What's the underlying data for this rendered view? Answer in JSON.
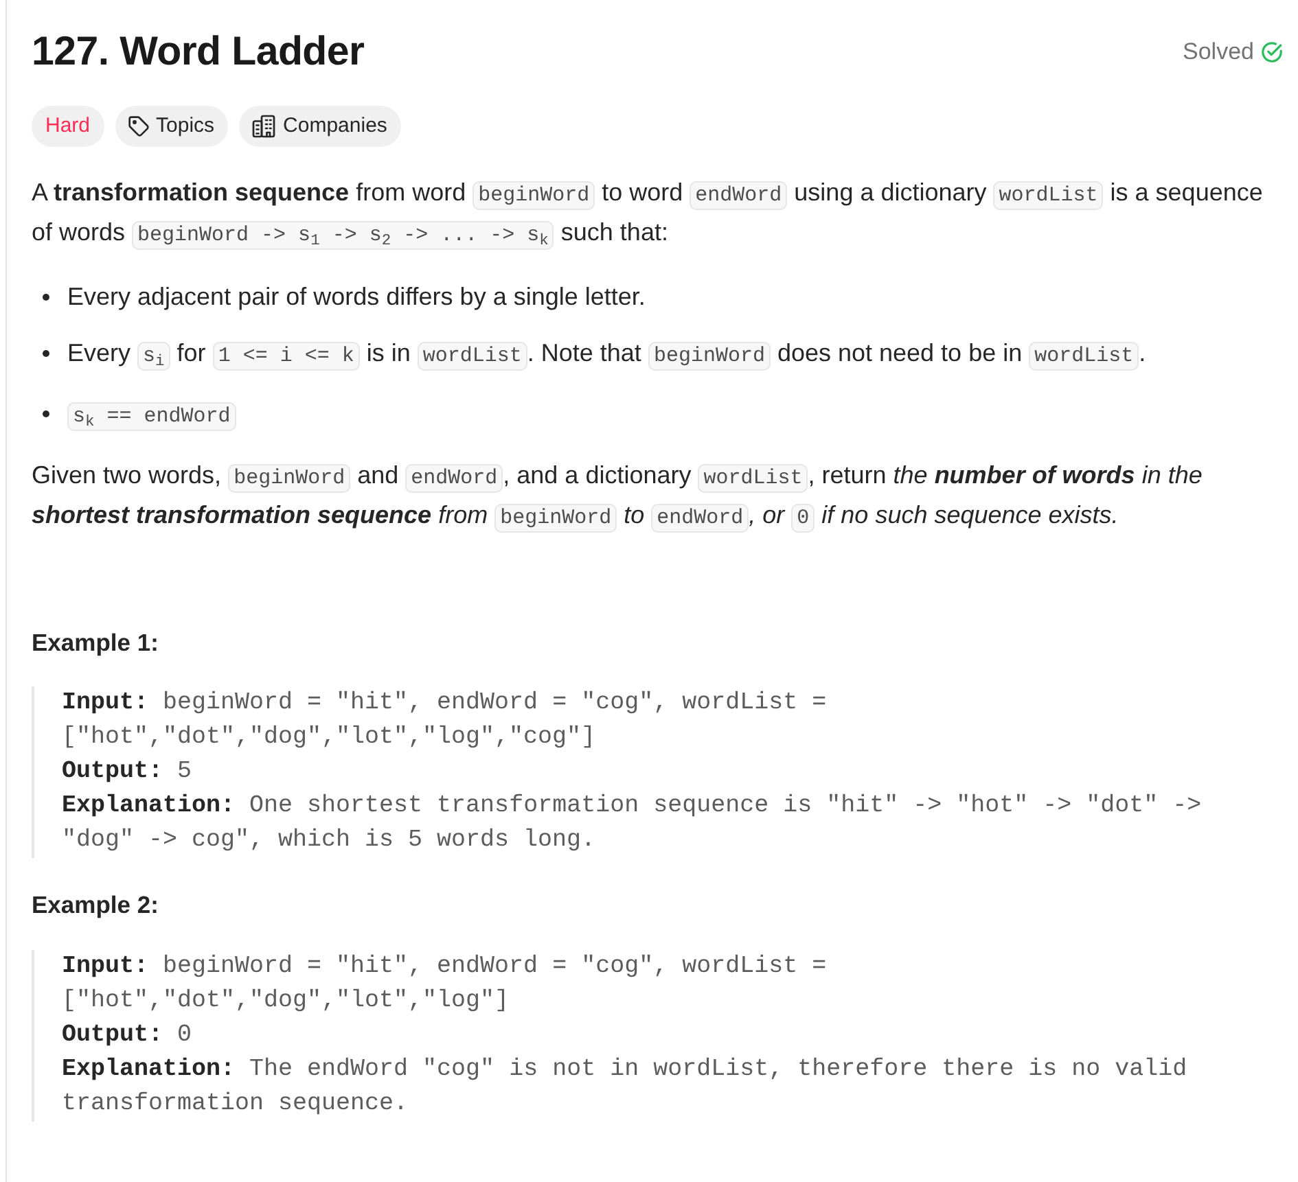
{
  "header": {
    "title": "127. Word Ladder",
    "status": "Solved"
  },
  "tags": [
    {
      "kind": "difficulty",
      "label": "Hard"
    },
    {
      "kind": "topics",
      "label": "Topics"
    },
    {
      "kind": "companies",
      "label": "Companies"
    }
  ],
  "description": [
    {
      "kind": "paragraph",
      "segments": [
        {
          "kind": "text",
          "text": "A **transformation sequence** from word "
        },
        {
          "kind": "code",
          "text": "beginWord"
        },
        {
          "kind": "text",
          "text": " to word "
        },
        {
          "kind": "code",
          "text": "endWord"
        },
        {
          "kind": "text",
          "text": " using a dictionary "
        },
        {
          "kind": "code",
          "text": "wordList"
        },
        {
          "kind": "text",
          "text": " is a sequence of words "
        },
        {
          "kind": "code",
          "text": "beginWord -> s$_{1}$ -> s$_{2}$ -> ... -> s$_{k}$"
        },
        {
          "kind": "text",
          "text": " such that:"
        }
      ]
    },
    {
      "kind": "bullets",
      "items": [
        {
          "segments": [
            {
              "kind": "text",
              "text": "Every adjacent pair of words differs by a single letter."
            }
          ]
        },
        {
          "segments": [
            {
              "kind": "text",
              "text": "Every "
            },
            {
              "kind": "code",
              "text": "s$_{i}$"
            },
            {
              "kind": "text",
              "text": " for "
            },
            {
              "kind": "code",
              "text": "1 <= i <= k"
            },
            {
              "kind": "text",
              "text": " is in "
            },
            {
              "kind": "code",
              "text": "wordList"
            },
            {
              "kind": "text",
              "text": ". Note that "
            },
            {
              "kind": "code",
              "text": "beginWord"
            },
            {
              "kind": "text",
              "text": " does not need to be in "
            },
            {
              "kind": "code",
              "text": "wordList"
            },
            {
              "kind": "text",
              "text": "."
            }
          ]
        },
        {
          "segments": [
            {
              "kind": "code",
              "text": "s$_{k}$ == endWord"
            }
          ]
        }
      ]
    },
    {
      "kind": "paragraph",
      "segments": [
        {
          "kind": "text",
          "text": "Given two words, "
        },
        {
          "kind": "code",
          "text": "beginWord"
        },
        {
          "kind": "text",
          "text": " and "
        },
        {
          "kind": "code",
          "text": "endWord"
        },
        {
          "kind": "text",
          "text": ", and a dictionary "
        },
        {
          "kind": "code",
          "text": "wordList"
        },
        {
          "kind": "text",
          "text": ", return "
        },
        {
          "kind": "emphasis",
          "text": "the **number of words** in the **shortest transformation sequence** from "
        },
        {
          "kind": "code",
          "text": "beginWord"
        },
        {
          "kind": "emphasis",
          "text": " to "
        },
        {
          "kind": "code",
          "text": "endWord"
        },
        {
          "kind": "emphasis",
          "text": ", or "
        },
        {
          "kind": "code",
          "text": "0"
        },
        {
          "kind": "emphasis",
          "text": " if no such sequence exists."
        }
      ]
    }
  ],
  "examples": [
    {
      "heading": "Example 1:",
      "lines": [
        "**Input:** beginWord = \"hit\", endWord = \"cog\", wordList = [\"hot\",\"dot\",\"dog\",\"lot\",\"log\",\"cog\"]",
        "**Output:** 5",
        "**Explanation:** One shortest transformation sequence is \"hit\" -> \"hot\" -> \"dot\" -> \"dog\" -> cog\", which is 5 words long."
      ]
    },
    {
      "heading": "Example 2:",
      "lines": [
        "**Input:** beginWord = \"hit\", endWord = \"cog\", wordList = [\"hot\",\"dot\",\"dog\",\"lot\",\"log\"]",
        "**Output:** 0",
        "**Explanation:** The endWord \"cog\" is not in wordList, therefore there is no valid transformation sequence."
      ]
    }
  ]
}
